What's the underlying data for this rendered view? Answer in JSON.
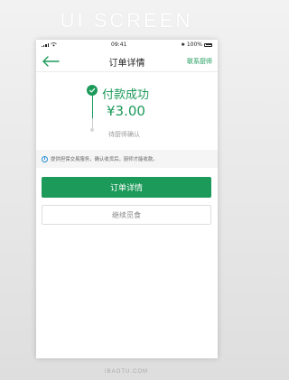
{
  "banner": {
    "title": "UI SCREEN"
  },
  "status_bar": {
    "time": "09:41",
    "battery_text": "100%",
    "bluetooth_symbol": "✱"
  },
  "nav": {
    "title": "订单详情",
    "contact": "联系厨师"
  },
  "payment": {
    "status": "付款成功",
    "amount": "¥3.00",
    "pending_text": "待厨师确认"
  },
  "info": {
    "text": "提供担保交易服务，确认收货后，厨师才能收款。"
  },
  "actions": {
    "primary_label": "订单详情",
    "secondary_label": "继续觅食"
  },
  "footer": {
    "watermark": "IBAOTU.COM"
  },
  "colors": {
    "accent": "#1c9a5a",
    "info_icon": "#2a8fd6"
  }
}
